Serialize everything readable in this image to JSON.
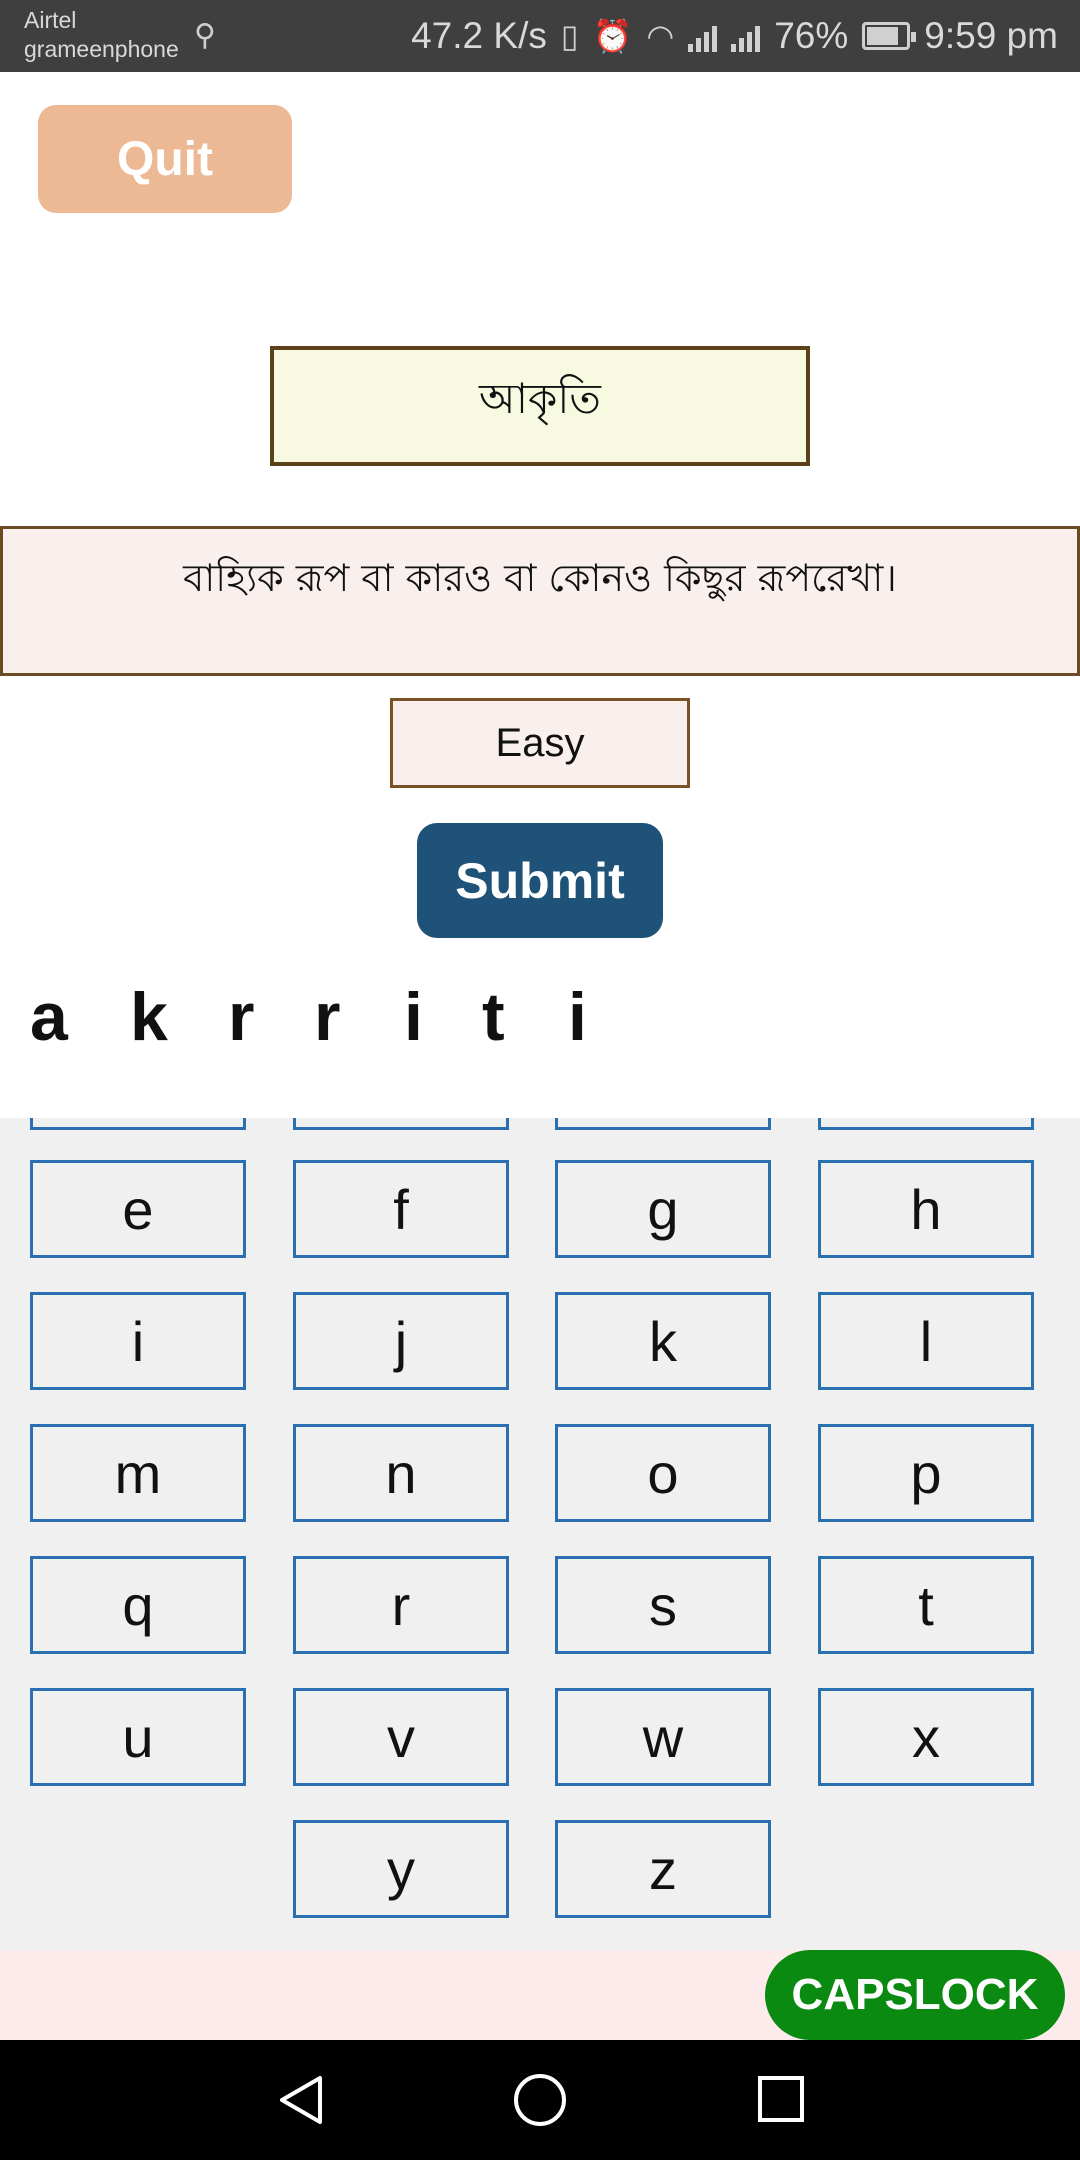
{
  "status_bar": {
    "carrier_line1": "Airtel",
    "carrier_line2": "grameenphone",
    "net_speed": "47.2 K/s",
    "battery": "76%",
    "time": "9:59 pm",
    "icons": [
      "usb-icon",
      "vibrate-icon",
      "alarm-icon",
      "wifi-icon",
      "signal-icon",
      "signal-icon",
      "battery-charging-icon"
    ]
  },
  "quit_label": "Quit",
  "word": "আকৃতি",
  "meaning": "বাহ্যিক রূপ বা কারও বা কোনও কিছুর রূপরেখা।",
  "difficulty": "Easy",
  "submit_label": "Submit",
  "answer_letters": [
    "a",
    "k",
    "r",
    "r",
    "i",
    "t",
    "i"
  ],
  "keys": [
    "e",
    "f",
    "g",
    "h",
    "i",
    "j",
    "k",
    "l",
    "m",
    "n",
    "o",
    "p",
    "q",
    "r",
    "s",
    "t",
    "u",
    "v",
    "w",
    "x",
    "y",
    "z"
  ],
  "capslock_label": "CAPSLOCK",
  "colors": {
    "quit": "#ecb994",
    "submit": "#1e5279",
    "capslock": "#0a8a10",
    "key_border": "#2a6fb0"
  }
}
